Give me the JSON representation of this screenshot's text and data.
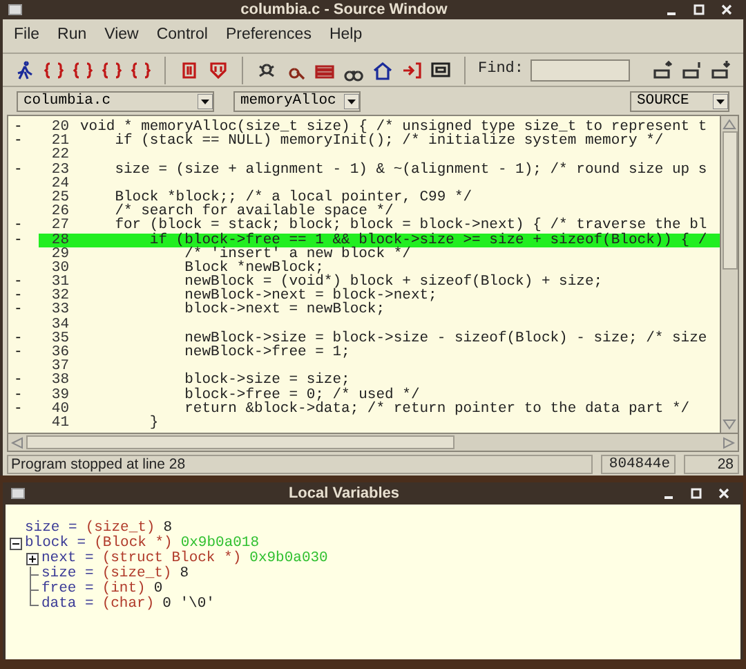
{
  "source_window": {
    "title": "columbia.c - Source Window",
    "menu": [
      "File",
      "Run",
      "View",
      "Control",
      "Preferences",
      "Help"
    ],
    "find": {
      "label": "Find:"
    },
    "selectors": [
      {
        "kind": "file",
        "value": "columbia.c"
      },
      {
        "kind": "function",
        "value": "memoryAlloc"
      },
      {
        "kind": "mode",
        "value": "SOURCE"
      }
    ],
    "code_lines": [
      {
        "number": "20",
        "marker": "-",
        "text": "void * memoryAlloc(size_t size) { /* unsigned type size_t to represent t",
        "selected": false
      },
      {
        "number": "21",
        "marker": "-",
        "text": "    if (stack == NULL) memoryInit(); /* initialize system memory */",
        "selected": false
      },
      {
        "number": "22",
        "selected": false
      },
      {
        "number": "23",
        "marker": "-",
        "text": "    size = (size + alignment - 1) & ~(alignment - 1); /* round size up s",
        "selected": false
      },
      {
        "number": "24",
        "selected": false
      },
      {
        "number": "25",
        "text": "    Block *block;; /* a local pointer, C99 */",
        "selected": false
      },
      {
        "number": "26",
        "text": "    /* search for available space */",
        "selected": false
      },
      {
        "number": "27",
        "marker": "-",
        "text": "    for (block = stack; block; block = block->next) { /* traverse the bl",
        "selected": false
      },
      {
        "number": "28",
        "marker": "-",
        "text": "        if (block->free == 1 && block->size >= size + sizeof(Block)) { /",
        "selected": true
      },
      {
        "number": "29",
        "text": "            /* 'insert' a new block */",
        "selected": false
      },
      {
        "number": "30",
        "text": "            Block *newBlock;",
        "selected": false
      },
      {
        "number": "31",
        "marker": "-",
        "text": "            newBlock = (void*) block + sizeof(Block) + size;",
        "selected": false
      },
      {
        "number": "32",
        "marker": "-",
        "text": "            newBlock->next = block->next;",
        "selected": false
      },
      {
        "number": "33",
        "marker": "-",
        "text": "            block->next = newBlock;",
        "selected": false
      },
      {
        "number": "34",
        "selected": false
      },
      {
        "number": "35",
        "marker": "-",
        "text": "            newBlock->size = block->size - sizeof(Block) - size; /* size",
        "selected": false
      },
      {
        "number": "36",
        "marker": "-",
        "text": "            newBlock->free = 1;",
        "selected": false
      },
      {
        "number": "37",
        "selected": false
      },
      {
        "number": "38",
        "marker": "-",
        "text": "            block->size = size;",
        "selected": false
      },
      {
        "number": "39",
        "marker": "-",
        "text": "            block->free = 0; /* used */",
        "selected": false
      },
      {
        "number": "40",
        "marker": "-",
        "text": "            return &block->data; /* return pointer to the data part */",
        "selected": false
      },
      {
        "number": "41",
        "text": "        }",
        "selected": false
      }
    ],
    "status_bar": {
      "message": "Program stopped at line 28",
      "address": "804844e",
      "line": "28"
    }
  },
  "locals_window": {
    "title": "Local Variables",
    "variables": [
      {
        "name": "size =",
        "type": "(size_t)",
        "value": "8",
        "kind": "scalar"
      },
      {
        "name": "block =",
        "type": "(Block *)",
        "value": "0x9b0a018",
        "kind": "pointer",
        "expanded": true,
        "children": [
          {
            "name": "next =",
            "type": "(struct Block *)",
            "value": "0x9b0a030",
            "kind": "pointer",
            "expanded": false
          },
          {
            "name": "size =",
            "type": "(size_t)",
            "value": "8",
            "kind": "scalar"
          },
          {
            "name": "free =",
            "type": "(int)",
            "value": "0",
            "kind": "scalar"
          },
          {
            "name": "data =",
            "type": "(char)",
            "value": "0 '\\0'",
            "kind": "scalar"
          }
        ]
      }
    ]
  }
}
